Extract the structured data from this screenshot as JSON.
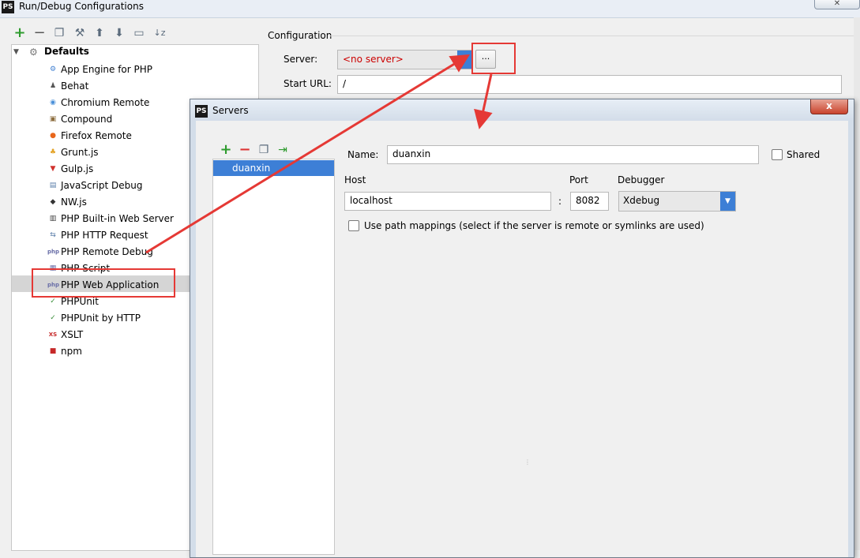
{
  "outer": {
    "app_icon": "PS",
    "title": "Run/Debug Configurations"
  },
  "toolbar_icons": [
    "add-icon",
    "remove-icon",
    "copy-icon",
    "wrench-icon",
    "arrow-up-icon",
    "arrow-down-icon",
    "folder-icon",
    "sort-icon"
  ],
  "tree": {
    "root": "Defaults",
    "items": [
      {
        "label": "App Engine for PHP",
        "icon": "app-engine-icon",
        "color": "#3f7fd1",
        "glyph": "⚙"
      },
      {
        "label": "Behat",
        "icon": "behat-icon",
        "color": "#555555",
        "glyph": "♟"
      },
      {
        "label": "Chromium Remote",
        "icon": "chromium-icon",
        "color": "#4a90d9",
        "glyph": "◉"
      },
      {
        "label": "Compound",
        "icon": "compound-icon",
        "color": "#8d6e3f",
        "glyph": "▣"
      },
      {
        "label": "Firefox Remote",
        "icon": "firefox-icon",
        "color": "#e8661b",
        "glyph": "●"
      },
      {
        "label": "Grunt.js",
        "icon": "grunt-icon",
        "color": "#e3a224",
        "glyph": "♣"
      },
      {
        "label": "Gulp.js",
        "icon": "gulp-icon",
        "color": "#d0312d",
        "glyph": "▼"
      },
      {
        "label": "JavaScript Debug",
        "icon": "js-debug-icon",
        "color": "#5a7da8",
        "glyph": "▤"
      },
      {
        "label": "NW.js",
        "icon": "nwjs-icon",
        "color": "#333333",
        "glyph": "◆"
      },
      {
        "label": "PHP Built-in Web Server",
        "icon": "php-builtin-server-icon",
        "color": "#3a3a3a",
        "glyph": "▥"
      },
      {
        "label": "PHP HTTP Request",
        "icon": "php-http-request-icon",
        "color": "#5a7da8",
        "glyph": "⇆"
      },
      {
        "label": "PHP Remote Debug",
        "icon": "php-remote-debug-icon",
        "color": "#6a6fa8",
        "glyph": "php"
      },
      {
        "label": "PHP Script",
        "icon": "php-script-icon",
        "color": "#6a6fa8",
        "glyph": "▦"
      },
      {
        "label": "PHP Web Application",
        "icon": "php-web-app-icon",
        "color": "#6a6fa8",
        "glyph": "php"
      },
      {
        "label": "PHPUnit",
        "icon": "phpunit-icon",
        "color": "#3c8f3c",
        "glyph": "✓"
      },
      {
        "label": "PHPUnit by HTTP",
        "icon": "phpunit-http-icon",
        "color": "#3c8f3c",
        "glyph": "✓"
      },
      {
        "label": "XSLT",
        "icon": "xslt-icon",
        "color": "#c62828",
        "glyph": "XS"
      },
      {
        "label": "npm",
        "icon": "npm-icon",
        "color": "#c62828",
        "glyph": "■"
      }
    ],
    "selected_index": 13
  },
  "config": {
    "section_title": "Configuration",
    "server_label": "Server:",
    "server_value": "<no server>",
    "dots_label": "...",
    "start_url_label": "Start URL:",
    "start_url_value": "/"
  },
  "dialog": {
    "app_icon": "PS",
    "title": "Servers",
    "close": "x",
    "servers": [
      "duanxin"
    ],
    "name_label": "Name:",
    "name_value": "duanxin",
    "shared_label": "Shared",
    "host_label": "Host",
    "host_value": "localhost",
    "port_label": "Port",
    "port_value": "8082",
    "colon": ":",
    "debugger_label": "Debugger",
    "debugger_value": "Xdebug",
    "path_mappings_label": "Use path mappings (select if the server is remote or symlinks are used)"
  },
  "annotation_color": "#e53935"
}
